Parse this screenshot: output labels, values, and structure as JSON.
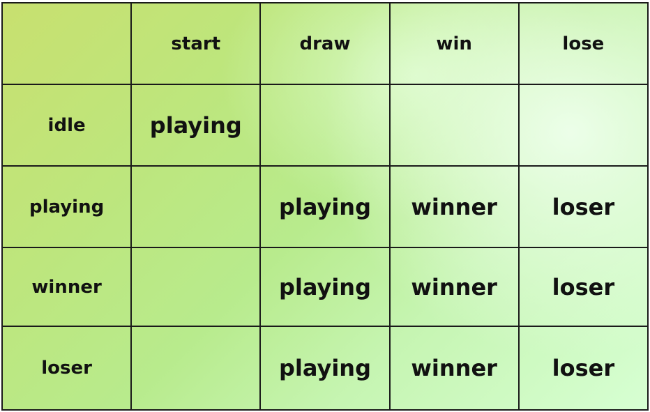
{
  "table": {
    "columns": [
      "",
      "start",
      "draw",
      "win",
      "lose"
    ],
    "rows": [
      {
        "state": "idle",
        "cells": [
          "playing",
          "",
          "",
          ""
        ]
      },
      {
        "state": "playing",
        "cells": [
          "",
          "playing",
          "winner",
          "loser"
        ]
      },
      {
        "state": "winner",
        "cells": [
          "",
          "playing",
          "winner",
          "loser"
        ]
      },
      {
        "state": "loser",
        "cells": [
          "",
          "playing",
          "winner",
          "loser"
        ]
      }
    ]
  }
}
